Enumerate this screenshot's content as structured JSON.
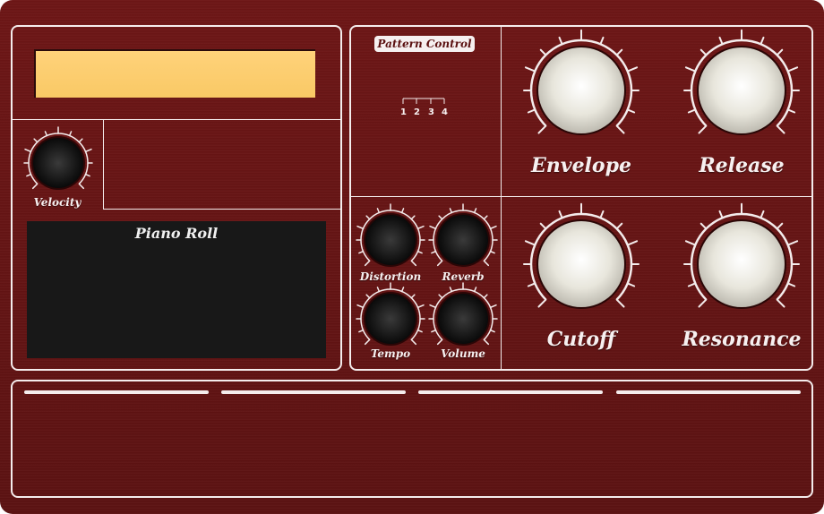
{
  "display": {
    "text": ""
  },
  "velocity": {
    "label": "Velocity"
  },
  "pattern": {
    "title": "Pattern Control",
    "steps": [
      "1",
      "2",
      "3",
      "4"
    ]
  },
  "small_knobs": [
    {
      "label": "Distortion"
    },
    {
      "label": "Reverb"
    },
    {
      "label": "Tempo"
    },
    {
      "label": "Volume"
    }
  ],
  "big_knobs": [
    {
      "label": "Envelope"
    },
    {
      "label": "Release"
    },
    {
      "label": "Cutoff"
    },
    {
      "label": "Resonance"
    }
  ],
  "piano_roll": {
    "title": "Piano Roll"
  },
  "sequencer": {
    "lanes": 4
  },
  "colors": {
    "panel_bg": "#6e1616",
    "border": "#f4ecec",
    "lcd": "#ffd27a",
    "piano_bg": "#181818"
  }
}
